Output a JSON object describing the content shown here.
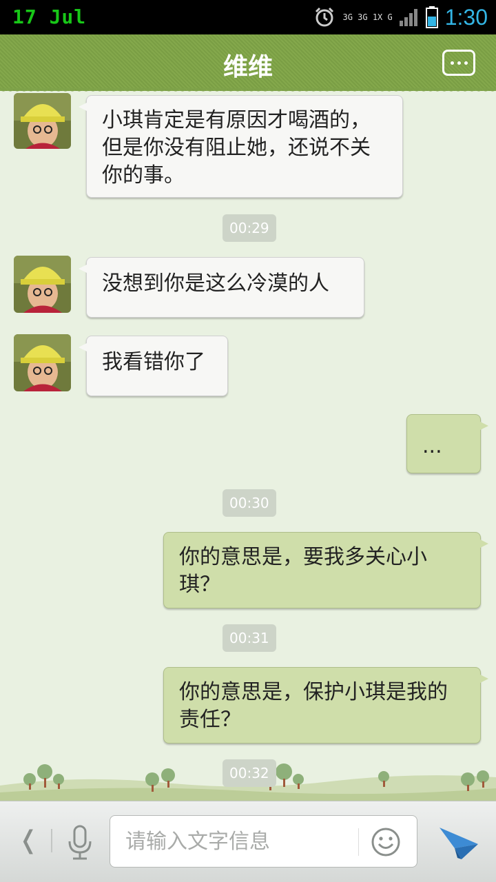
{
  "status_bar": {
    "date": "17  Jul",
    "network": "3G 3G 1X  G",
    "time": "1:30"
  },
  "header": {
    "title": "维维",
    "menu_icon": "chat-menu-icon"
  },
  "messages": [
    {
      "sender": "contact",
      "text": "小琪肯定是有原因才喝酒的，但是你没有阻止她，还说不关你的事。"
    },
    {
      "type": "time",
      "text": "00:29"
    },
    {
      "sender": "contact",
      "text": "没想到你是这么冷漠的人"
    },
    {
      "sender": "contact",
      "text": "我看错你了"
    },
    {
      "sender": "me",
      "text": "..."
    },
    {
      "type": "time",
      "text": "00:30"
    },
    {
      "sender": "me",
      "text": "你的意思是，要我多关心小琪？"
    },
    {
      "type": "time",
      "text": "00:31"
    },
    {
      "sender": "me",
      "text": "你的意思是，保护小琪是我的责任？"
    },
    {
      "type": "time",
      "text": "00:32"
    }
  ],
  "input_bar": {
    "placeholder": "请输入文字信息",
    "back_icon": "chevron-left-icon",
    "voice_icon": "microphone-icon",
    "emoji_icon": "smiley-icon",
    "send_icon": "paper-plane-send-icon"
  },
  "colors": {
    "header": "#7ea249",
    "background": "#e9f1e1",
    "incoming_bubble": "#f7f7f5",
    "outgoing_bubble": "#cfdeaa",
    "send_blue": "#2f7fc9"
  }
}
